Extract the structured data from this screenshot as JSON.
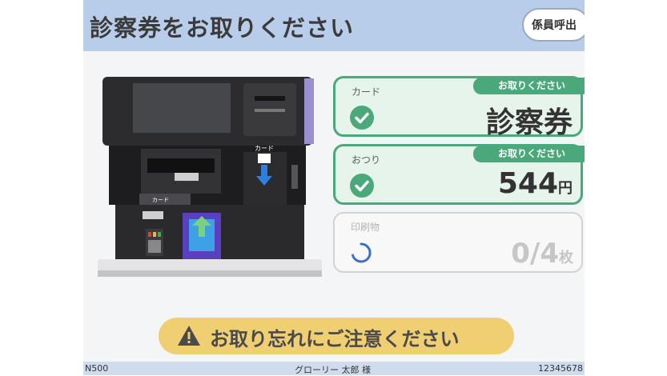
{
  "header": {
    "title": "診察券をお取りください",
    "staff_call_label": "係員呼出"
  },
  "status_cards": [
    {
      "label": "カード",
      "badge": "お取りください",
      "value": "診察券",
      "unit": "",
      "state": "done"
    },
    {
      "label": "おつり",
      "badge": "お取りください",
      "value": "544",
      "unit": "円",
      "state": "done"
    },
    {
      "label": "印刷物",
      "badge": "",
      "value": "0/4",
      "unit": "枚",
      "state": "pending",
      "progress": 0
    }
  ],
  "machine_labels": {
    "card_slot": "カード",
    "card_reader": "カード"
  },
  "warning": {
    "text": "お取り忘れにご注意ください",
    "icon": "warning-triangle-icon"
  },
  "footer": {
    "model": "N500",
    "user": "グローリー 太郎 様",
    "number": "12345678"
  },
  "colors": {
    "header_bg": "#b8cdea",
    "done_green": "#4aa87b",
    "warning_bg": "#f0cf72",
    "pending_gray": "#c6c6c6"
  }
}
